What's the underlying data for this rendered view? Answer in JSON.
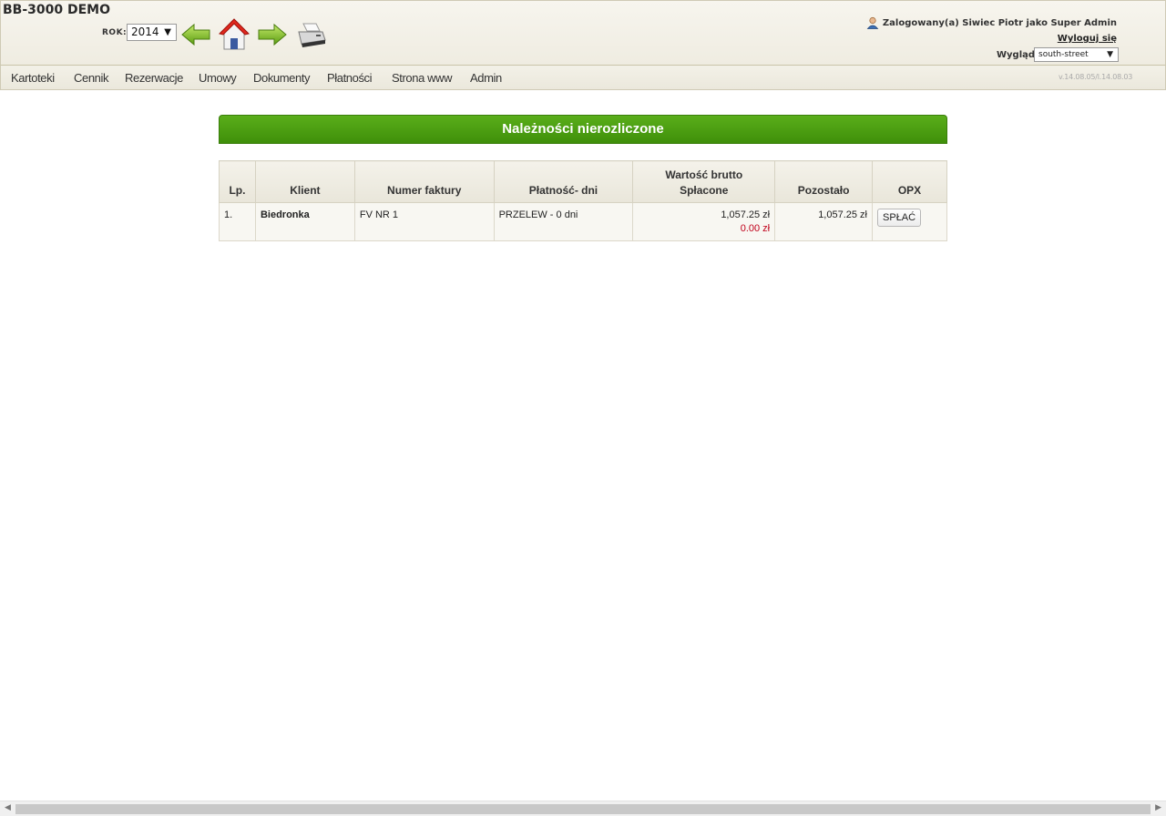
{
  "app": {
    "title": "BB-3000 DEMO",
    "version": "v.14.08.05/l.14.08.03"
  },
  "header": {
    "year_label": "ROK:",
    "year_value": "2014",
    "user_text": "Zalogowany(a) Siwiec Piotr jako Super Admin",
    "logout_label": "Wyloguj się",
    "theme_label": "Wygląd:",
    "theme_value": "south-street",
    "icons": [
      "arrow-left-icon",
      "home-icon",
      "arrow-right-icon",
      "printer-icon",
      "user-icon"
    ]
  },
  "nav": {
    "items": [
      {
        "label": "Kartoteki"
      },
      {
        "label": "Cennik"
      },
      {
        "label": "Rezerwacje"
      },
      {
        "label": "Umowy"
      },
      {
        "label": "Dokumenty"
      },
      {
        "label": "Płatności"
      },
      {
        "label": "Strona www"
      },
      {
        "label": "Admin"
      }
    ]
  },
  "main": {
    "title": "Należności nierozliczone",
    "columns": {
      "lp": "Lp.",
      "client": "Klient",
      "invoice": "Numer faktury",
      "payment": "Płatność- dni",
      "gross_top": "Wartość brutto",
      "gross_bottom": "Spłacone",
      "remaining": "Pozostało",
      "opx": "OPX"
    },
    "rows": [
      {
        "lp": "1.",
        "client": "Biedronka",
        "invoice": "FV NR 1",
        "payment": "PRZELEW - 0 dni",
        "gross": "1,057.25 zł",
        "paid": "0.00 zł",
        "remaining": "1,057.25 zł",
        "action": "SPŁAĆ"
      }
    ]
  },
  "colors": {
    "banner": "#4a9e12",
    "paid_text": "#c0001a"
  }
}
